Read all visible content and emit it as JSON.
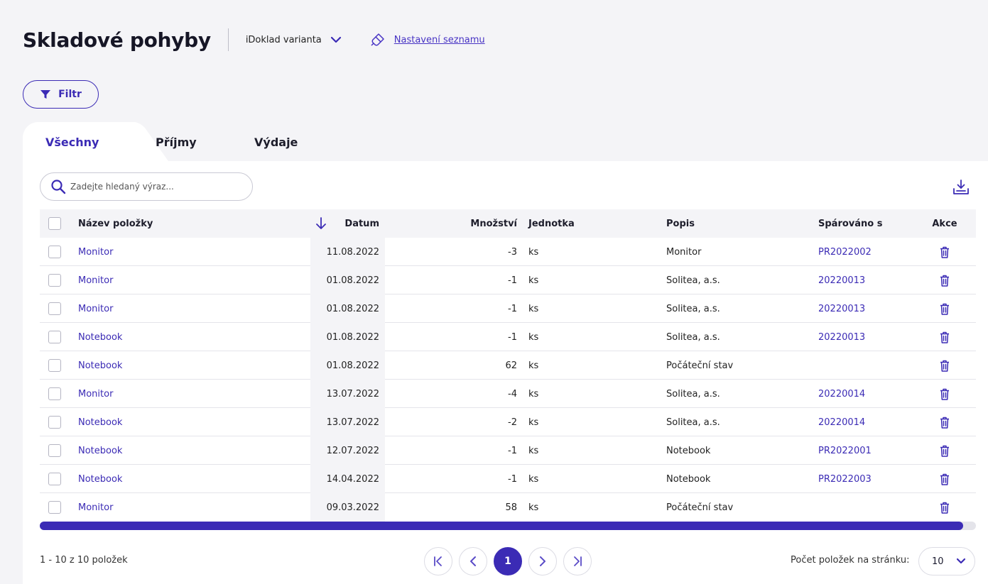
{
  "header": {
    "title": "Skladové pohyby",
    "variant_label": "iDoklad varianta",
    "settings_link": "Nastavení seznamu"
  },
  "filter": {
    "label": "Filtr"
  },
  "tabs": [
    {
      "label": "Všechny",
      "active": true
    },
    {
      "label": "Příjmy",
      "active": false
    },
    {
      "label": "Výdaje",
      "active": false
    }
  ],
  "search": {
    "placeholder": "Zadejte hledaný výraz..."
  },
  "table": {
    "columns": {
      "name": "Název položky",
      "date": "Datum",
      "qty": "Množství",
      "unit": "Jednotka",
      "desc": "Popis",
      "paired": "Spárováno s",
      "actions": "Akce"
    },
    "rows": [
      {
        "name": "Monitor",
        "date": "11.08.2022",
        "qty": "-3",
        "unit": "ks",
        "desc": "Monitor",
        "paired": "PR2022002"
      },
      {
        "name": "Monitor",
        "date": "01.08.2022",
        "qty": "-1",
        "unit": "ks",
        "desc": "Solitea, a.s.",
        "paired": "20220013"
      },
      {
        "name": "Monitor",
        "date": "01.08.2022",
        "qty": "-1",
        "unit": "ks",
        "desc": "Solitea, a.s.",
        "paired": "20220013"
      },
      {
        "name": "Notebook",
        "date": "01.08.2022",
        "qty": "-1",
        "unit": "ks",
        "desc": "Solitea, a.s.",
        "paired": "20220013"
      },
      {
        "name": "Notebook",
        "date": "01.08.2022",
        "qty": "62",
        "unit": "ks",
        "desc": "Počáteční stav",
        "paired": ""
      },
      {
        "name": "Monitor",
        "date": "13.07.2022",
        "qty": "-4",
        "unit": "ks",
        "desc": "Solitea, a.s.",
        "paired": "20220014"
      },
      {
        "name": "Notebook",
        "date": "13.07.2022",
        "qty": "-2",
        "unit": "ks",
        "desc": "Solitea, a.s.",
        "paired": "20220014"
      },
      {
        "name": "Notebook",
        "date": "12.07.2022",
        "qty": "-1",
        "unit": "ks",
        "desc": "Notebook",
        "paired": "PR2022001"
      },
      {
        "name": "Notebook",
        "date": "14.04.2022",
        "qty": "-1",
        "unit": "ks",
        "desc": "Notebook",
        "paired": "PR2022003"
      },
      {
        "name": "Monitor",
        "date": "09.03.2022",
        "qty": "58",
        "unit": "ks",
        "desc": "Počáteční stav",
        "paired": ""
      }
    ]
  },
  "footer": {
    "count_text": "1 - 10 z 10 položek",
    "current_page": "1",
    "per_page_label": "Počet položek na stránku:",
    "per_page_value": "10"
  },
  "colors": {
    "accent": "#3b2bb5",
    "background": "#f4f4f7"
  },
  "icons": {
    "variant": "chevron-down-icon",
    "settings": "brush-icon",
    "filter": "funnel-icon",
    "search": "search-icon",
    "export": "download-tray-icon",
    "sort": "arrow-down-icon",
    "delete": "trash-icon"
  }
}
